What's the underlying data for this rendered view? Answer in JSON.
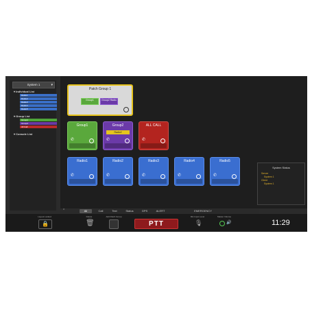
{
  "sidebar": {
    "system_select": "System 1",
    "sections": {
      "individual": "Individual List",
      "group": "Group List",
      "console": "Console List"
    },
    "individual_items": [
      "Radio1",
      "Radio2",
      "Radio3",
      "Radio4",
      "Radio5"
    ],
    "group_items": [
      "Group1",
      "Group2",
      "All Call"
    ]
  },
  "patch": {
    "title": "Patch Group 1",
    "members": [
      "Group1",
      "Group2 Radio"
    ]
  },
  "groups": [
    {
      "name": "Group1",
      "color": "#5aa83c"
    },
    {
      "name": "Group2",
      "badge": "Radio2",
      "color": "#6b3aa8"
    },
    {
      "name": "ALL CALL",
      "color": "#b3241f"
    }
  ],
  "radios": [
    "Radio1",
    "Radio2",
    "Radio3",
    "Radio4",
    "Radio5"
  ],
  "status_panel": {
    "title": "System Status",
    "lines": [
      "Server",
      "System 1",
      "Client",
      "System 1"
    ]
  },
  "tabs": [
    "All",
    "Call",
    "Text",
    "Status",
    "GPS",
    "ALERT",
    "EMERGENCY"
  ],
  "bottom": {
    "layout_label": "Layout Locked",
    "delete_label": "Delete",
    "add_patch_label": "Add Patch Group",
    "ptt_label": "PTT",
    "mic_label": "Mic Input Level",
    "master_label": "Master Volume",
    "clock": "11:29"
  }
}
